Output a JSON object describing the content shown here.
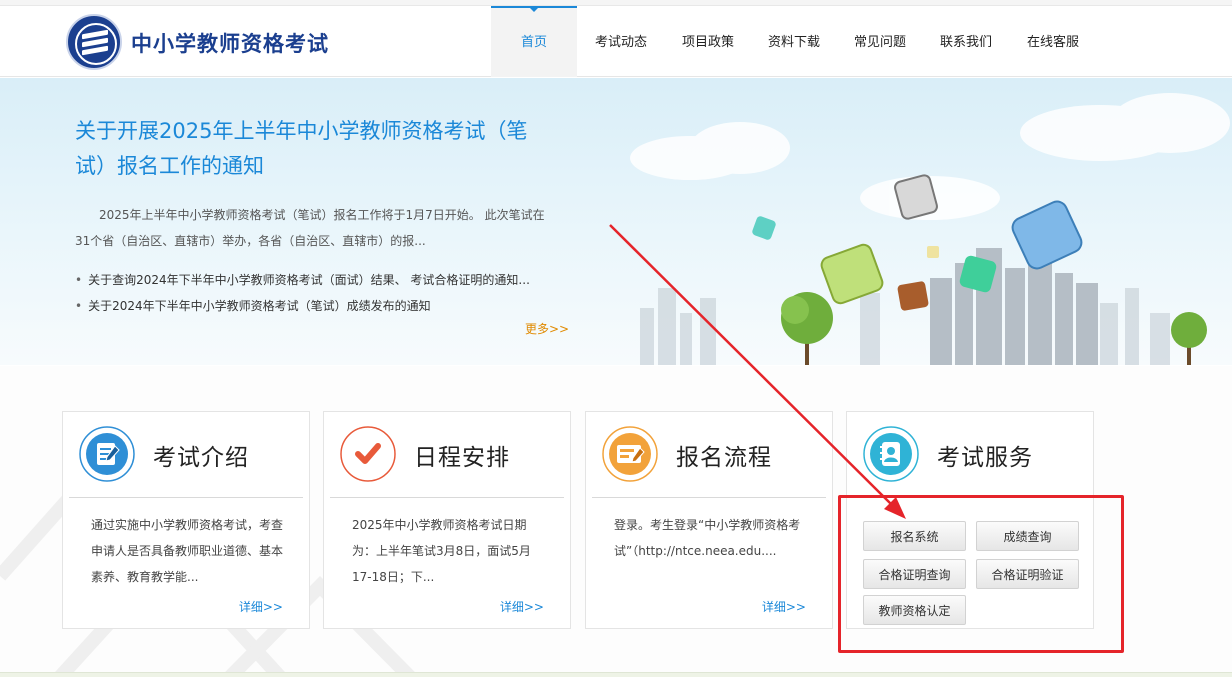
{
  "header": {
    "site_title": "中小学教师资格考试",
    "nav": [
      {
        "label": "首页",
        "active": true
      },
      {
        "label": "考试动态",
        "active": false
      },
      {
        "label": "项目政策",
        "active": false
      },
      {
        "label": "资料下载",
        "active": false
      },
      {
        "label": "常见问题",
        "active": false
      },
      {
        "label": "联系我们",
        "active": false
      },
      {
        "label": "在线客服",
        "active": false
      }
    ]
  },
  "banner": {
    "headline": "关于开展2025年上半年中小学教师资格考试（笔试）报名工作的通知",
    "summary": "2025年上半年中小学教师资格考试（笔试）报名工作将于1月7日开始。  此次笔试在31个省（自治区、直辖市）举办，各省（自治区、直辖市）的报...",
    "news": [
      "关于查询2024年下半年中小学教师资格考试（面试）结果、 考试合格证明的通知...",
      "关于2024年下半年中小学教师资格考试（笔试）成绩发布的通知"
    ],
    "more": "更多>>"
  },
  "cards": [
    {
      "title": "考试介绍",
      "text": "通过实施中小学教师资格考试，考查申请人是否具备教师职业道德、基本素养、教育教学能...",
      "more": "详细>>"
    },
    {
      "title": "日程安排",
      "text": "2025年中小学教师资格考试日期为：上半年笔试3月8日，面试5月17-18日；下...",
      "more": "详细>>"
    },
    {
      "title": "报名流程",
      "text": "登录。考生登录“中小学教师资格考试”（http://ntce.neea.edu....",
      "more": "详细>>"
    }
  ],
  "service": {
    "title": "考试服务",
    "buttons": [
      "报名系统",
      "成绩查询",
      "合格证明查询",
      "合格证明验证",
      "教师资格认定"
    ]
  },
  "colors": {
    "brand_blue": "#1b3f8f",
    "link_blue": "#1b88d8",
    "more_orange": "#e08a00",
    "highlight_red": "#e5242a"
  },
  "icons": {
    "logo": "book-emblem-logo",
    "card_1": "document-pen-icon",
    "card_2": "checkmark-icon",
    "card_3": "registration-form-icon",
    "card_4": "contact-book-icon"
  }
}
